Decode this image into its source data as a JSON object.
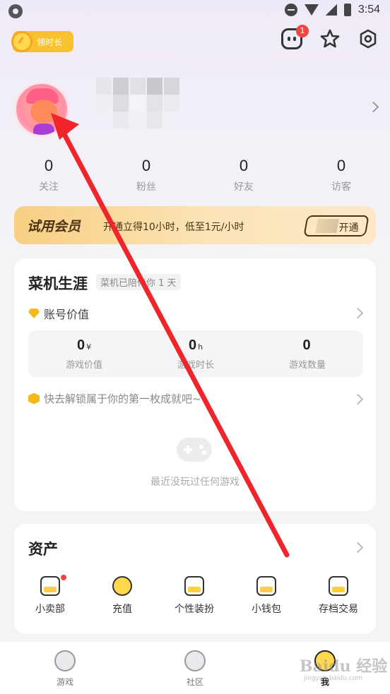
{
  "statusbar": {
    "time": "3:54"
  },
  "header": {
    "time_badge_label": "领时长",
    "message_badge_count": "1"
  },
  "profile": {
    "stats": [
      {
        "value": "0",
        "label": "关注"
      },
      {
        "value": "0",
        "label": "粉丝"
      },
      {
        "value": "0",
        "label": "好友"
      },
      {
        "value": "0",
        "label": "访客"
      }
    ]
  },
  "membership": {
    "title": "试用会员",
    "description": "开通立得10小时，低至1元/小时",
    "open_label": "开通"
  },
  "career": {
    "title": "菜机生涯",
    "tag": "菜机已陪伴你 1 天",
    "account_value_label": "账号价值",
    "metrics": [
      {
        "value": "0",
        "unit": "¥",
        "label": "游戏价值"
      },
      {
        "value": "0",
        "unit": "h",
        "label": "游戏时长"
      },
      {
        "value": "0",
        "unit": "",
        "label": "游戏数量"
      }
    ],
    "achievement_label": "快去解锁属于你的第一枚成就吧~",
    "empty_text": "最近没玩过任何游戏"
  },
  "assets": {
    "title": "资产",
    "items": [
      {
        "label": "小卖部",
        "icon": "shop-icon"
      },
      {
        "label": "充值",
        "icon": "coin-icon"
      },
      {
        "label": "个性装扮",
        "icon": "dress-up-icon"
      },
      {
        "label": "小钱包",
        "icon": "wallet-icon"
      },
      {
        "label": "存档交易",
        "icon": "save-trade-icon"
      }
    ]
  },
  "bottom_nav": [
    {
      "label": "游戏",
      "icon": "game-icon"
    },
    {
      "label": "社区",
      "icon": "planet-icon"
    },
    {
      "label": "我",
      "icon": "me-icon"
    }
  ],
  "watermark": {
    "text": "Baidu 经验",
    "sub": "jingyan.baidu.com"
  },
  "colors": {
    "accent": "#f8c12f",
    "arrow": "#f0242b",
    "badge": "#f04545"
  }
}
